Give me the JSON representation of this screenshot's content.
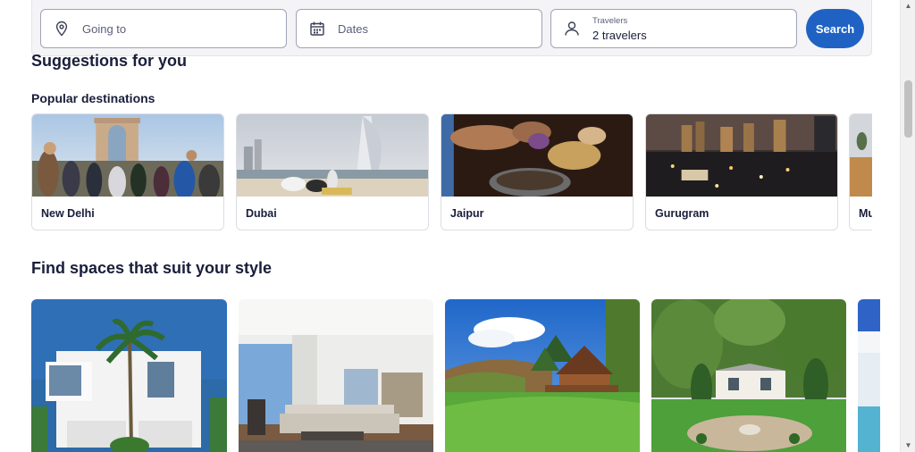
{
  "search": {
    "going_to_placeholder": "Going to",
    "dates_placeholder": "Dates",
    "travelers_label": "Travelers",
    "travelers_value": "2 travelers",
    "search_button": "Search"
  },
  "suggestions": {
    "heading": "Suggestions for you",
    "popular_heading": "Popular destinations",
    "destinations": [
      {
        "name": "New Delhi"
      },
      {
        "name": "Dubai"
      },
      {
        "name": "Jaipur"
      },
      {
        "name": "Gurugram"
      },
      {
        "name": "Mu"
      }
    ]
  },
  "spaces": {
    "heading": "Find spaces that suit your style"
  },
  "colors": {
    "accent": "#1f62c4",
    "text": "#191e3b"
  },
  "icons": [
    "location-pin-icon",
    "calendar-icon",
    "person-icon",
    "scroll-up-icon",
    "scroll-down-icon"
  ]
}
